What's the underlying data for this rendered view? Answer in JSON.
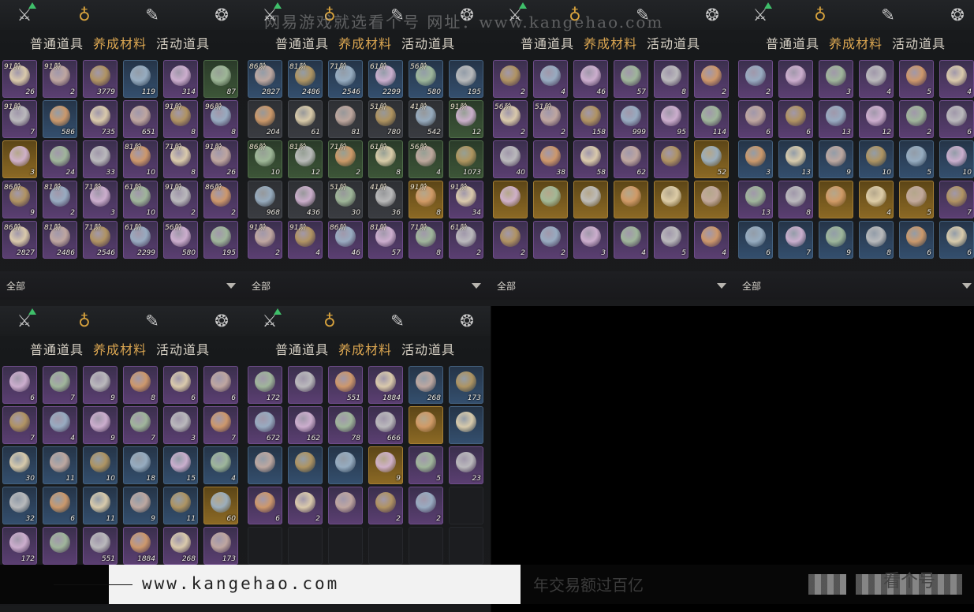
{
  "tabs": [
    "普通道具",
    "养成材料",
    "活动道具"
  ],
  "filter": "全部",
  "watermark_text": "网易游戏就选看个号  网址：www.kangehao.com",
  "footer": {
    "url": "www.kangehao.com",
    "slogan": "年交易额过百亿",
    "brand": "看个号"
  },
  "panels": [
    {
      "rows": [
        [
          [
            "91阶",
            "26",
            "purple"
          ],
          [
            "91阶",
            "2",
            "purple"
          ],
          [
            "",
            "3779",
            "purple"
          ],
          [
            "",
            "119",
            "blue"
          ],
          [
            "",
            "314",
            "purple"
          ],
          [
            "",
            "87",
            "green"
          ]
        ],
        [
          [
            "91阶",
            "7",
            "purple"
          ],
          [
            "",
            "586",
            "blue"
          ],
          [
            "",
            "735",
            "purple"
          ],
          [
            "",
            "651",
            "purple"
          ],
          [
            "91阶",
            "8",
            "purple"
          ],
          [
            "96阶",
            "8",
            "purple"
          ]
        ],
        [
          [
            "",
            "3",
            "gold"
          ],
          [
            "",
            "24",
            "purple"
          ],
          [
            "",
            "33",
            "purple"
          ],
          [
            "81阶",
            "10",
            "purple"
          ],
          [
            "71阶",
            "8",
            "purple"
          ],
          [
            "91阶",
            "26",
            "purple"
          ]
        ],
        [
          [
            "86阶",
            "9",
            "purple"
          ],
          [
            "81阶",
            "2",
            "purple"
          ],
          [
            "71阶",
            "3",
            "purple"
          ],
          [
            "61阶",
            "10",
            "purple"
          ],
          [
            "91阶",
            "2",
            "purple"
          ],
          [
            "86阶",
            "2",
            "purple"
          ]
        ],
        [
          [
            "86阶",
            "2827",
            "purple"
          ],
          [
            "81阶",
            "2486",
            "purple"
          ],
          [
            "71阶",
            "2546",
            "purple"
          ],
          [
            "61阶",
            "2299",
            "purple"
          ],
          [
            "56阶",
            "580",
            "purple"
          ],
          [
            "",
            "195",
            "purple"
          ]
        ]
      ]
    },
    {
      "rows": [
        [
          [
            "86阶",
            "2827",
            "blue"
          ],
          [
            "81阶",
            "2486",
            "blue"
          ],
          [
            "71阶",
            "2546",
            "blue"
          ],
          [
            "61阶",
            "2299",
            "blue"
          ],
          [
            "56阶",
            "580",
            "blue"
          ],
          [
            "",
            "195",
            "blue"
          ]
        ],
        [
          [
            "",
            "204",
            "grey"
          ],
          [
            "",
            "61",
            "grey"
          ],
          [
            "",
            "81",
            "grey"
          ],
          [
            "51阶",
            "780",
            "grey"
          ],
          [
            "41阶",
            "542",
            "grey"
          ],
          [
            "91阶",
            "12",
            "green"
          ]
        ],
        [
          [
            "86阶",
            "10",
            "green"
          ],
          [
            "81阶",
            "12",
            "green"
          ],
          [
            "71阶",
            "2",
            "green"
          ],
          [
            "61阶",
            "8",
            "green"
          ],
          [
            "56阶",
            "4",
            "green"
          ],
          [
            "",
            "1073",
            "green"
          ]
        ],
        [
          [
            "",
            "968",
            "grey"
          ],
          [
            "",
            "436",
            "grey"
          ],
          [
            "51阶",
            "30",
            "grey"
          ],
          [
            "41阶",
            "36",
            "grey"
          ],
          [
            "91阶",
            "8",
            "gold"
          ],
          [
            "91阶",
            "34",
            "purple"
          ]
        ],
        [
          [
            "91阶",
            "2",
            "purple"
          ],
          [
            "91阶",
            "4",
            "purple"
          ],
          [
            "86阶",
            "46",
            "purple"
          ],
          [
            "81阶",
            "57",
            "purple"
          ],
          [
            "71阶",
            "8",
            "purple"
          ],
          [
            "61阶",
            "2",
            "purple"
          ]
        ]
      ]
    },
    {
      "rows": [
        [
          [
            "",
            "2",
            "purple"
          ],
          [
            "",
            "4",
            "purple"
          ],
          [
            "",
            "46",
            "purple"
          ],
          [
            "",
            "57",
            "purple"
          ],
          [
            "",
            "8",
            "purple"
          ],
          [
            "",
            "2",
            "purple"
          ]
        ],
        [
          [
            "56阶",
            "2",
            "purple"
          ],
          [
            "51阶",
            "2",
            "purple"
          ],
          [
            "",
            "158",
            "purple"
          ],
          [
            "",
            "999",
            "purple"
          ],
          [
            "",
            "95",
            "purple"
          ],
          [
            "",
            "114",
            "purple"
          ]
        ],
        [
          [
            "",
            "40",
            "purple"
          ],
          [
            "",
            "38",
            "purple"
          ],
          [
            "",
            "58",
            "purple"
          ],
          [
            "",
            "62",
            "purple"
          ],
          [
            "",
            "",
            "purple"
          ],
          [
            "",
            "52",
            "gold"
          ]
        ],
        [
          [
            "",
            "",
            "gold"
          ],
          [
            "",
            "",
            "gold"
          ],
          [
            "",
            "",
            "gold"
          ],
          [
            "",
            "",
            "gold"
          ],
          [
            "",
            "",
            "gold"
          ],
          [
            "",
            "",
            "gold"
          ]
        ],
        [
          [
            "",
            "2",
            "purple"
          ],
          [
            "",
            "2",
            "purple"
          ],
          [
            "",
            "3",
            "purple"
          ],
          [
            "",
            "4",
            "purple"
          ],
          [
            "",
            "5",
            "purple"
          ],
          [
            "",
            "4",
            "purple"
          ]
        ]
      ]
    },
    {
      "rows": [
        [
          [
            "",
            "2",
            "purple"
          ],
          [
            "",
            "",
            "purple"
          ],
          [
            "",
            "3",
            "purple"
          ],
          [
            "",
            "4",
            "purple"
          ],
          [
            "",
            "5",
            "purple"
          ],
          [
            "",
            "4",
            "purple"
          ]
        ],
        [
          [
            "",
            "6",
            "purple"
          ],
          [
            "",
            "6",
            "purple"
          ],
          [
            "",
            "13",
            "purple"
          ],
          [
            "",
            "12",
            "purple"
          ],
          [
            "",
            "2",
            "purple"
          ],
          [
            "",
            "6",
            "purple"
          ]
        ],
        [
          [
            "",
            "3",
            "blue"
          ],
          [
            "",
            "13",
            "blue"
          ],
          [
            "",
            "9",
            "blue"
          ],
          [
            "",
            "10",
            "blue"
          ],
          [
            "",
            "5",
            "blue"
          ],
          [
            "",
            "10",
            "blue"
          ]
        ],
        [
          [
            "",
            "13",
            "purple"
          ],
          [
            "",
            "8",
            "purple"
          ],
          [
            "",
            "",
            "gold"
          ],
          [
            "",
            "4",
            "gold"
          ],
          [
            "",
            "5",
            "gold"
          ],
          [
            "",
            "7",
            "purple"
          ]
        ],
        [
          [
            "",
            "6",
            "blue"
          ],
          [
            "",
            "7",
            "blue"
          ],
          [
            "",
            "9",
            "blue"
          ],
          [
            "",
            "8",
            "blue"
          ],
          [
            "",
            "6",
            "blue"
          ],
          [
            "",
            "6",
            "blue"
          ]
        ]
      ]
    },
    {
      "rows": [
        [
          [
            "",
            "6",
            "purple"
          ],
          [
            "",
            "7",
            "purple"
          ],
          [
            "",
            "9",
            "purple"
          ],
          [
            "",
            "8",
            "purple"
          ],
          [
            "",
            "6",
            "purple"
          ],
          [
            "",
            "6",
            "purple"
          ]
        ],
        [
          [
            "",
            "7",
            "purple"
          ],
          [
            "",
            "4",
            "purple"
          ],
          [
            "",
            "9",
            "purple"
          ],
          [
            "",
            "7",
            "purple"
          ],
          [
            "",
            "3",
            "purple"
          ],
          [
            "",
            "7",
            "purple"
          ]
        ],
        [
          [
            "",
            "30",
            "blue"
          ],
          [
            "",
            "11",
            "blue"
          ],
          [
            "",
            "10",
            "blue"
          ],
          [
            "",
            "18",
            "blue"
          ],
          [
            "",
            "15",
            "blue"
          ],
          [
            "",
            "4",
            "blue"
          ]
        ],
        [
          [
            "",
            "32",
            "blue"
          ],
          [
            "",
            "6",
            "blue"
          ],
          [
            "",
            "11",
            "blue"
          ],
          [
            "",
            "9",
            "blue"
          ],
          [
            "",
            "11",
            "blue"
          ],
          [
            "",
            "60",
            "gold"
          ]
        ],
        [
          [
            "",
            "172",
            "purple"
          ],
          [
            "",
            "",
            "purple"
          ],
          [
            "",
            "551",
            "purple"
          ],
          [
            "",
            "1884",
            "purple"
          ],
          [
            "",
            "268",
            "purple"
          ],
          [
            "",
            "173",
            "purple"
          ]
        ]
      ]
    },
    {
      "rows": [
        [
          [
            "",
            "172",
            "purple"
          ],
          [
            "",
            "",
            "purple"
          ],
          [
            "",
            "551",
            "purple"
          ],
          [
            "",
            "1884",
            "purple"
          ],
          [
            "",
            "268",
            "blue"
          ],
          [
            "",
            "173",
            "blue"
          ]
        ],
        [
          [
            "",
            "672",
            "purple"
          ],
          [
            "",
            "162",
            "purple"
          ],
          [
            "",
            "78",
            "purple"
          ],
          [
            "",
            "666",
            "purple"
          ],
          [
            "",
            "",
            "gold"
          ],
          [
            "",
            "",
            "blue"
          ]
        ],
        [
          [
            "",
            "",
            "blue"
          ],
          [
            "",
            "",
            "blue"
          ],
          [
            "",
            "",
            "blue"
          ],
          [
            "",
            "9",
            "gold"
          ],
          [
            "",
            "5",
            "purple"
          ],
          [
            "",
            "23",
            "purple"
          ]
        ],
        [
          [
            "",
            "6",
            "purple"
          ],
          [
            "",
            "2",
            "purple"
          ],
          [
            "",
            "",
            "purple"
          ],
          [
            "",
            "2",
            "purple"
          ],
          [
            "",
            "2",
            "purple"
          ],
          [
            "",
            "",
            "empty"
          ]
        ],
        [
          [
            "",
            "",
            "empty"
          ],
          [
            "",
            "",
            "empty"
          ],
          [
            "",
            "",
            "empty"
          ],
          [
            "",
            "",
            "empty"
          ],
          [
            "",
            "",
            "empty"
          ],
          [
            "",
            "",
            "empty"
          ]
        ]
      ]
    }
  ]
}
